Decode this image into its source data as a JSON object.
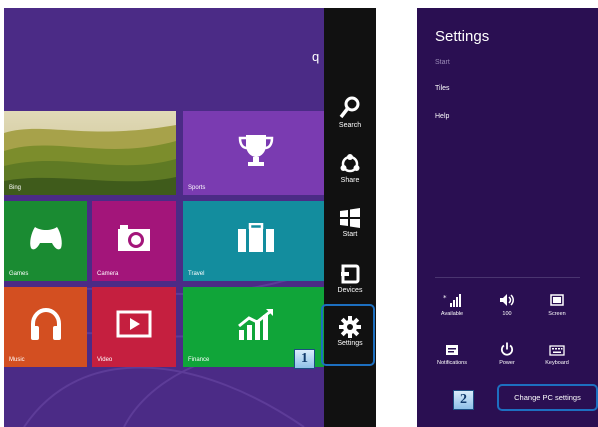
{
  "start_screen": {
    "search_text": "q",
    "tiles": [
      {
        "id": "bing",
        "label": "Bing",
        "color": "#7f8a3a"
      },
      {
        "id": "sports",
        "label": "Sports",
        "color": "#7a3bb1"
      },
      {
        "id": "games",
        "label": "Games",
        "color": "#1a8b32"
      },
      {
        "id": "camera",
        "label": "Camera",
        "color": "#a3157a"
      },
      {
        "id": "travel",
        "label": "Travel",
        "color": "#138d9e"
      },
      {
        "id": "music",
        "label": "Music",
        "color": "#d34f21"
      },
      {
        "id": "video",
        "label": "Video",
        "color": "#c51f3f"
      },
      {
        "id": "finance",
        "label": "Finance",
        "color": "#10a539"
      }
    ]
  },
  "charms": [
    {
      "id": "search",
      "label": "Search",
      "icon": "search-icon"
    },
    {
      "id": "share",
      "label": "Share",
      "icon": "share-icon"
    },
    {
      "id": "start",
      "label": "Start",
      "icon": "windows-logo-icon"
    },
    {
      "id": "devices",
      "label": "Devices",
      "icon": "devices-icon"
    },
    {
      "id": "settings",
      "label": "Settings",
      "icon": "gear-icon"
    }
  ],
  "callouts": {
    "step1": "1",
    "step2": "2"
  },
  "settings_pane": {
    "title": "Settings",
    "subtitle": "Start",
    "links": [
      "Tiles",
      "Help"
    ],
    "quick_settings": [
      {
        "label": "Available",
        "icon": "network-icon"
      },
      {
        "label": "100",
        "icon": "volume-icon"
      },
      {
        "label": "Screen",
        "icon": "screen-icon"
      },
      {
        "label": "Notifications",
        "icon": "notifications-icon"
      },
      {
        "label": "Power",
        "icon": "power-icon"
      },
      {
        "label": "Keyboard",
        "icon": "keyboard-icon"
      }
    ],
    "change_pc_settings": "Change PC settings"
  },
  "colors": {
    "start_bg": "#4b2b86",
    "charm_bg": "#111111",
    "pane_bg": "#2a0f52",
    "highlight": "#1d6fc0"
  }
}
